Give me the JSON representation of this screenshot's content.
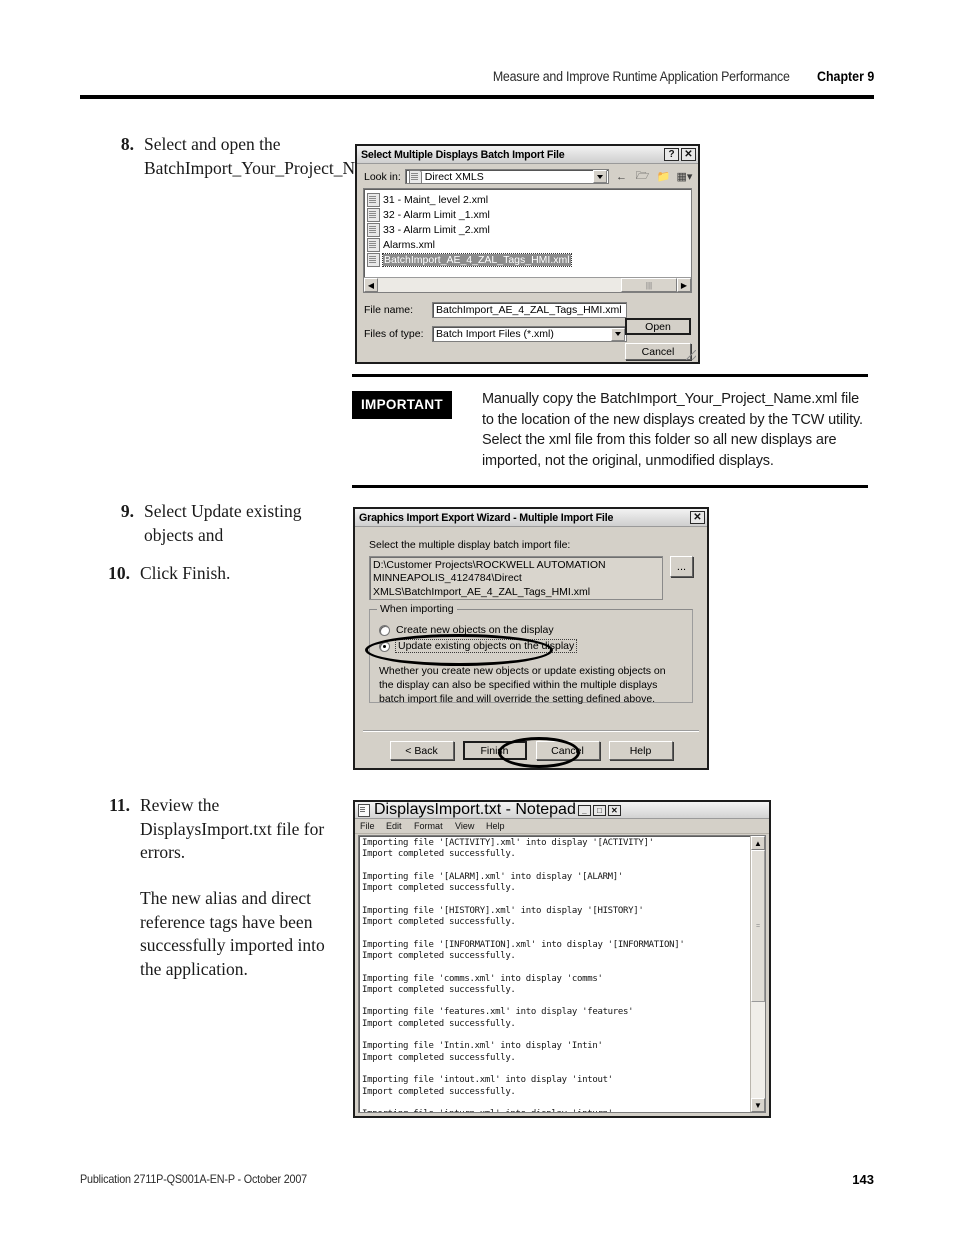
{
  "header": {
    "title": "Measure and Improve Runtime Application Performance",
    "chapter": "Chapter 9"
  },
  "footer": {
    "publication": "Publication 2711P-QS001A-EN-P - October 2007",
    "page_number": "143"
  },
  "steps": [
    {
      "num": "8.",
      "text": "Select and open the BatchImport_Your_Project_Name.xml"
    },
    {
      "num": "9.",
      "text": "Select Update existing objects and"
    },
    {
      "num": "10.",
      "text": "Click Finish."
    },
    {
      "num": "11.",
      "text": "Review the DisplaysImport.txt file for errors.",
      "text2": "The new alias and direct reference tags have been successfully imported into the application."
    }
  ],
  "callout": {
    "tag": "IMPORTANT",
    "message": "Manually copy the BatchImport_Your_Project_Name.xml  file to the location of the new displays created by the TCW utility. Select the xml file from this folder so all new displays are imported, not the original, unmodified displays."
  },
  "file_dialog": {
    "title": "Select Multiple Displays Batch Import File",
    "help_button": "?",
    "close_button": "✕",
    "look_in_label": "Look in:",
    "look_in_value": "Direct XMLS",
    "toolbar_icons": [
      "back-icon",
      "up-one-level-icon",
      "new-folder-icon",
      "views-icon"
    ],
    "files": [
      "31 - Maint_ level 2.xml",
      "32 - Alarm Limit _1.xml",
      "33 - Alarm Limit _2.xml",
      "Alarms.xml",
      "BatchImport_AE_4_ZAL_Tags_HMI.xml"
    ],
    "selected_file": "BatchImport_AE_4_ZAL_Tags_HMI.xml",
    "file_name_label": "File name:",
    "file_name_value": "BatchImport_AE_4_ZAL_Tags_HMI.xml",
    "files_of_type_label": "Files of type:",
    "files_of_type_value": "Batch Import Files (*.xml)",
    "open_button": "Open",
    "cancel_button": "Cancel"
  },
  "wizard_dialog": {
    "title": "Graphics Import Export Wizard - Multiple Import File",
    "close_button": "✕",
    "prompt": "Select the multiple display batch import file:",
    "path_value": "D:\\Customer Projects\\ROCKWELL AUTOMATION MINNEAPOLIS_4124784\\Direct XMLS\\BatchImport_AE_4_ZAL_Tags_HMI.xml",
    "browse_button": "...",
    "group_title": "When importing",
    "radio_create": "Create new objects on the display",
    "radio_update": "Update existing objects on the display",
    "selected_radio": "Update existing objects on the display",
    "hint": "Whether you create new objects or update existing objects on the display can also be specified within the multiple displays batch import file and will override the setting defined above.",
    "back_button": "< Back",
    "finish_button": "Finish",
    "cancel_button": "Cancel",
    "help_button": "Help"
  },
  "notepad": {
    "title": "DisplaysImport.txt - Notepad",
    "minimize_button": "_",
    "maximize_button": "□",
    "close_button": "✕",
    "menu": [
      "File",
      "Edit",
      "Format",
      "View",
      "Help"
    ],
    "content": "Importing file '[ACTIVITY].xml' into display '[ACTIVITY]'\nImport completed successfully.\n\nImporting file '[ALARM].xml' into display '[ALARM]'\nImport completed successfully.\n\nImporting file '[HISTORY].xml' into display '[HISTORY]'\nImport completed successfully.\n\nImporting file '[INFORMATION].xml' into display '[INFORMATION]'\nImport completed successfully.\n\nImporting file 'comms.xml' into display 'comms'\nImport completed successfully.\n\nImporting file 'features.xml' into display 'features'\nImport completed successfully.\n\nImporting file 'Intin.xml' into display 'Intin'\nImport completed successfully.\n\nImporting file 'intout.xml' into display 'intout'\nImport completed successfully.\n\nImporting file 'inturn.xml' into display 'inturn'\nImport completed successfully.\n\nImporting file 'Main Menu.xml' into display 'Main Menu'\nImport completed successfully.\n\nImporting file 'overall.xml' into display 'overall'\nImport completed successfully."
  }
}
